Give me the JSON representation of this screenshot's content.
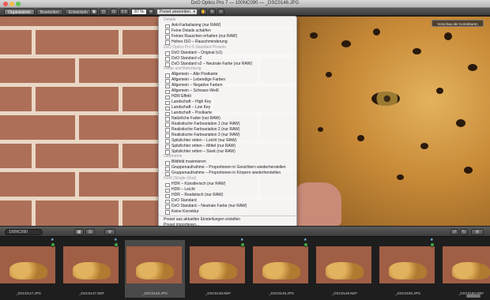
{
  "window": {
    "title": "DxO Optics Pro 7 — 100NC090 — _DSC0148.JPG"
  },
  "toolbar": {
    "tabs": [
      {
        "label": "Organisieren",
        "active": true
      },
      {
        "label": "Bearbeiten",
        "active": false
      },
      {
        "label": "Entwickeln",
        "active": false
      }
    ],
    "ratio_label": "1:1",
    "zoom_value": "87 %",
    "preset_button_label": "Preset anwenden"
  },
  "viewer": {
    "compare_label": "Vorschau der Korrekturen"
  },
  "preset_menu": {
    "rows": [
      {
        "type": "header",
        "label": "Details"
      },
      {
        "type": "item",
        "label": "Anti-Farbaliasing (nur RAW)"
      },
      {
        "type": "item",
        "label": "Feine Details schärfen"
      },
      {
        "type": "item",
        "label": "Feines Rauschen erhalten (nur RAW)"
      },
      {
        "type": "item",
        "label": "Hohes ISO – Rauschminderung"
      },
      {
        "type": "header",
        "label": "DxO Optics Pro 6 Standard Presets"
      },
      {
        "type": "item",
        "label": "DxO Standard – Original (v1)"
      },
      {
        "type": "item",
        "label": "DxO Standard v2"
      },
      {
        "type": "item",
        "label": "DxO Standard v2 – Neutrale Farbe (nur RAW)"
      },
      {
        "type": "header",
        "label": "Farbe und Belichtung"
      },
      {
        "type": "item",
        "label": "Allgemein – Alte Postkarte"
      },
      {
        "type": "item",
        "label": "Allgemein – Lebendige Farben"
      },
      {
        "type": "item",
        "label": "Allgemein – Negative Farben"
      },
      {
        "type": "item",
        "label": "Allgemein – Schwarz-Weiß"
      },
      {
        "type": "item",
        "label": "HDR Effekt"
      },
      {
        "type": "item",
        "label": "Landschaft – High Key"
      },
      {
        "type": "item",
        "label": "Landschaft – Low Key"
      },
      {
        "type": "item",
        "label": "Landschaft – Postkarte"
      },
      {
        "type": "item",
        "label": "Natürliche Farbe (nur RAW)"
      },
      {
        "type": "item",
        "label": "Realistische Farbvariation 1 (nur RAW)"
      },
      {
        "type": "item",
        "label": "Realistische Farbvariation 2 (nur RAW)"
      },
      {
        "type": "item",
        "label": "Realistische Farbvariation 3 (nur RAW)"
      },
      {
        "type": "item",
        "label": "Spitzlichter retten – Leicht (nur RAW)"
      },
      {
        "type": "item",
        "label": "Spitzlichter retten – Mittel (nur RAW)"
      },
      {
        "type": "item",
        "label": "Spitzlichter retten – Stark (nur RAW)"
      },
      {
        "type": "header",
        "label": "Geometrie"
      },
      {
        "type": "item",
        "label": "Bildfeld maximieren"
      },
      {
        "type": "item",
        "label": "Gruppenaufnahme – Proportionen in Gesichtern wiederherstellen"
      },
      {
        "type": "item",
        "label": "Gruppenaufnahme – Proportionen in Körpern wiederherstellen"
      },
      {
        "type": "header",
        "label": "HDR (Single-Shot)"
      },
      {
        "type": "item",
        "label": "HDR – Künstlerisch (nur RAW)"
      },
      {
        "type": "item",
        "label": "HDR – Leicht"
      },
      {
        "type": "item",
        "label": "HDR – Realistisch (nur RAW)"
      },
      {
        "type": "item",
        "label": "DxO Standard"
      },
      {
        "type": "item",
        "label": "DxO Standard – Neutrale Farbe (nur RAW)"
      },
      {
        "type": "item",
        "label": "Keine Korrektur"
      },
      {
        "type": "separator",
        "label": ""
      },
      {
        "type": "plain",
        "label": "Preset aus aktuellen Einstellungen erstellen"
      },
      {
        "type": "plain",
        "label": "Preset importieren..."
      }
    ]
  },
  "filmbar": {
    "folder_label": "100NC090"
  },
  "filmstrip": {
    "thumbs": [
      {
        "caption": "_DSC0147.JPG",
        "selected": false,
        "processed": true
      },
      {
        "caption": "_DSC0147.NEF",
        "selected": false,
        "processed": true
      },
      {
        "caption": "_DSC0148.JPG",
        "selected": true,
        "processed": false
      },
      {
        "caption": "_DSC0148.NEF",
        "selected": false,
        "processed": true
      },
      {
        "caption": "_DSC0149.JPG",
        "selected": false,
        "processed": true
      },
      {
        "caption": "_DSC0149.NEF",
        "selected": false,
        "processed": false
      },
      {
        "caption": "_DSC0150.JPG",
        "selected": false,
        "processed": true
      },
      {
        "caption": "_DSC0150.NEF",
        "selected": false,
        "processed": false
      }
    ]
  },
  "colors": {
    "menu_bg": "#f8f8f8",
    "processed_badge": "#3fa73f",
    "selected_thumb": "#4a4a4a"
  }
}
